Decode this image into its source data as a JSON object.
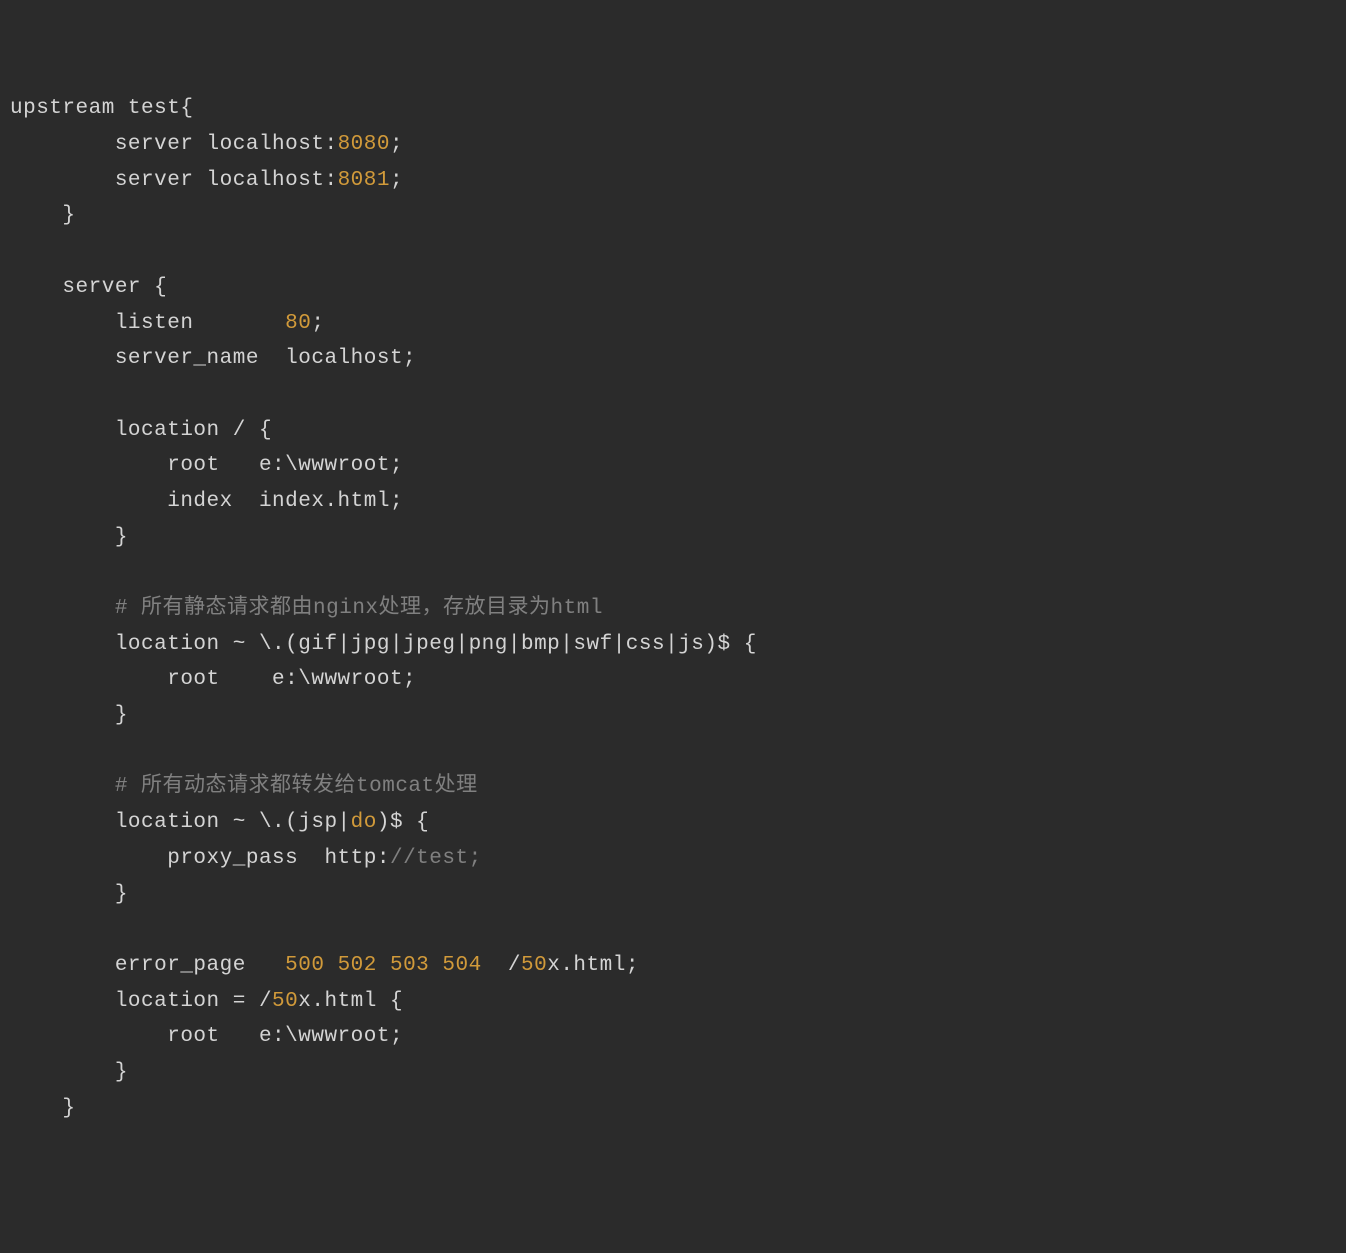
{
  "l1_a": "upstream test{",
  "l2_a": "        server localhost:",
  "l2_b": "8080",
  "l2_c": ";",
  "l3_a": "        server localhost:",
  "l3_b": "8081",
  "l3_c": ";",
  "l4_a": "    }",
  "l5_a": "",
  "l6_a": "    server {",
  "l7_a": "        listen       ",
  "l7_b": "80",
  "l7_c": ";",
  "l8_a": "        server_name  localhost;",
  "l9_a": "",
  "l10_a": "        location / {",
  "l11_a": "            root   e:\\wwwroot;",
  "l12_a": "            index  index.html;",
  "l13_a": "        }",
  "l14_a": "",
  "l15_a": "        # 所有静态请求都由nginx处理，存放目录为html",
  "l16_a": "        location ~ \\.(gif|jpg|jpeg|png|bmp|swf|css|js)$ {",
  "l17_a": "            root    e:\\wwwroot;",
  "l18_a": "        }",
  "l19_a": "",
  "l20_a": "        # 所有动态请求都转发给tomcat处理",
  "l21_a": "        location ~ \\.(jsp|",
  "l21_b": "do",
  "l21_c": ")$ {",
  "l22_a": "            proxy_pass  http:",
  "l22_b": "//test;",
  "l23_a": "        }",
  "l24_a": "",
  "l25_a": "        error_page   ",
  "l25_b": "500 502 503 504",
  "l25_c": "  /",
  "l25_d": "50",
  "l25_e": "x.html;",
  "l26_a": "        location = /",
  "l26_b": "50",
  "l26_c": "x.html {",
  "l27_a": "            root   e:\\wwwroot;",
  "l28_a": "        }",
  "l29_a": "    }"
}
